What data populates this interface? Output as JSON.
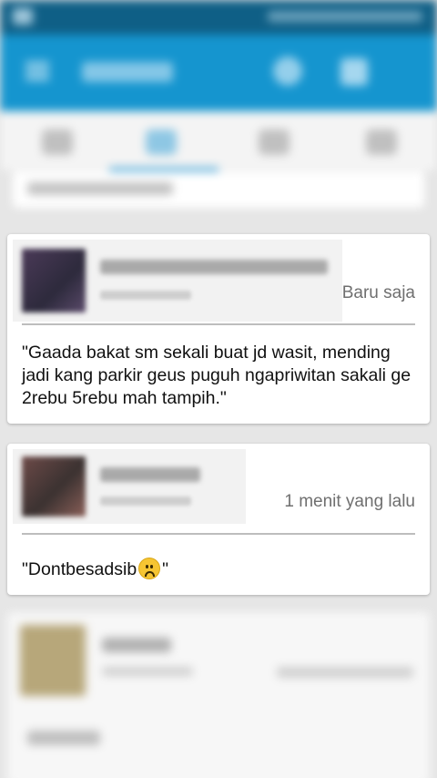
{
  "comments": [
    {
      "timestamp": "Baru saja",
      "text": "\"Gaada bakat sm sekali buat jd wasit, mending jadi kang parkir geus puguh ngapriwitan sakali ge 2rebu 5rebu mah tampih.\""
    },
    {
      "timestamp": "1 menit yang lalu",
      "text_before": "\"Dontbesadsib",
      "text_after": "\"",
      "emoji": "frowning-face-icon"
    }
  ],
  "colors": {
    "appbar": "#1595cf",
    "statusbar": "#0f5f86",
    "background": "#e6e6e6"
  }
}
